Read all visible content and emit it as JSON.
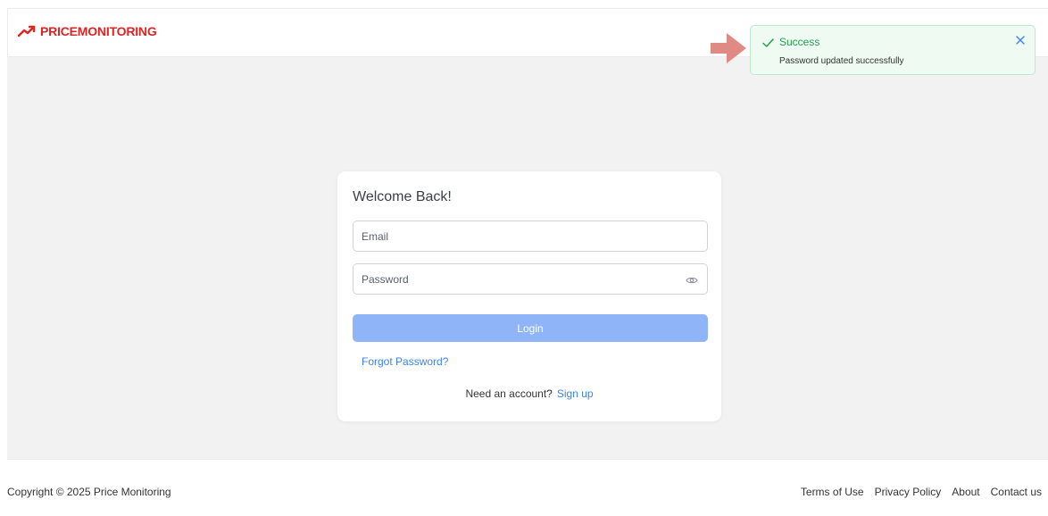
{
  "brand": {
    "name": "PRICEMONITORING",
    "color": "#e02424",
    "icon": "trending-up-icon"
  },
  "login": {
    "title": "Welcome Back!",
    "email_placeholder": "Email",
    "password_placeholder": "Password",
    "password_toggle_icon": "eye-icon",
    "login_label": "Login",
    "forgot_label": "Forgot Password?",
    "signup_prompt": "Need an account?",
    "signup_label": "Sign up",
    "accent_color": "#3b82f6",
    "button_color": "#8fb4f8"
  },
  "toast": {
    "title": "Success",
    "message": "Password updated successfully",
    "status_color": "#22a04b",
    "icon": "check-icon",
    "close_icon": "close-icon"
  },
  "annotation": {
    "icon": "arrow-right-icon",
    "color": "#e08a85"
  },
  "footer": {
    "copyright": "Copyright © 2025 Price Monitoring",
    "links": [
      "Terms of Use",
      "Privacy Policy",
      "About",
      "Contact us"
    ]
  }
}
